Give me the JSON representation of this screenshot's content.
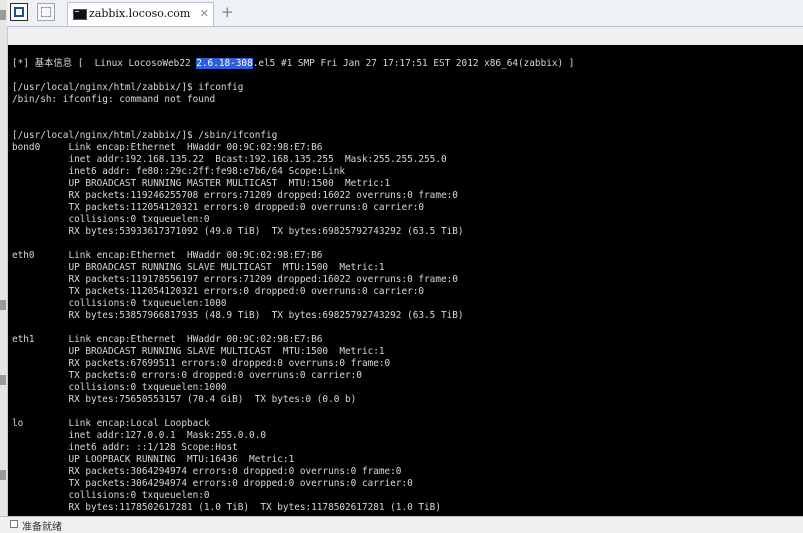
{
  "tabs": [
    {
      "label": "zabbix.locoso.com"
    }
  ],
  "toolbar": {
    "buttons": [
      {
        "icon": "window-layout-icon",
        "active": true
      },
      {
        "icon": "window-inactive-icon",
        "active": false
      }
    ]
  },
  "new_tab_label": "+",
  "terminal": {
    "banner": {
      "pre": "[*] 基本信息 [  Linux LocosoWeb22 ",
      "highlight": "2.6.18-308",
      "post": ".el5 #1 SMP Fri Jan 27 17:17:51 EST 2012 x86_64(zabbix) ]"
    },
    "lines": [
      "[/usr/local/nginx/html/zabbix/]$ ifconfig",
      "/bin/sh: ifconfig: command not found",
      "",
      "",
      "[/usr/local/nginx/html/zabbix/]$ /sbin/ifconfig",
      "bond0     Link encap:Ethernet  HWaddr 00:9C:02:98:E7:B6",
      "          inet addr:192.168.135.22  Bcast:192.168.135.255  Mask:255.255.255.0",
      "          inet6 addr: fe80::29c:2ff:fe98:e7b6/64 Scope:Link",
      "          UP BROADCAST RUNNING MASTER MULTICAST  MTU:1500  Metric:1",
      "          RX packets:119246255708 errors:71209 dropped:16022 overruns:0 frame:0",
      "          TX packets:112054120321 errors:0 dropped:0 overruns:0 carrier:0",
      "          collisions:0 txqueuelen:0",
      "          RX bytes:53933617371092 (49.0 TiB)  TX bytes:69825792743292 (63.5 TiB)",
      "",
      "eth0      Link encap:Ethernet  HWaddr 00:9C:02:98:E7:B6",
      "          UP BROADCAST RUNNING SLAVE MULTICAST  MTU:1500  Metric:1",
      "          RX packets:119178556197 errors:71209 dropped:16022 overruns:0 frame:0",
      "          TX packets:112054120321 errors:0 dropped:0 overruns:0 carrier:0",
      "          collisions:0 txqueuelen:1000",
      "          RX bytes:53857966817935 (48.9 TiB)  TX bytes:69825792743292 (63.5 TiB)",
      "",
      "eth1      Link encap:Ethernet  HWaddr 00:9C:02:98:E7:B6",
      "          UP BROADCAST RUNNING SLAVE MULTICAST  MTU:1500  Metric:1",
      "          RX packets:67699511 errors:0 dropped:0 overruns:0 frame:0",
      "          TX packets:0 errors:0 dropped:0 overruns:0 carrier:0",
      "          collisions:0 txqueuelen:1000",
      "          RX bytes:75650553157 (70.4 GiB)  TX bytes:0 (0.0 b)",
      "",
      "lo        Link encap:Local Loopback",
      "          inet addr:127.0.0.1  Mask:255.0.0.0",
      "          inet6 addr: ::1/128 Scope:Host",
      "          UP LOOPBACK RUNNING  MTU:16436  Metric:1",
      "          RX packets:3064294974 errors:0 dropped:0 overruns:0 frame:0",
      "          TX packets:3064294974 errors:0 dropped:0 overruns:0 carrier:0",
      "          collisions:0 txqueuelen:0",
      "          RX bytes:1178502617281 (1.0 TiB)  TX bytes:1178502617281 (1.0 TiB)"
    ]
  },
  "statusbar": {
    "text": "准备就绪"
  }
}
